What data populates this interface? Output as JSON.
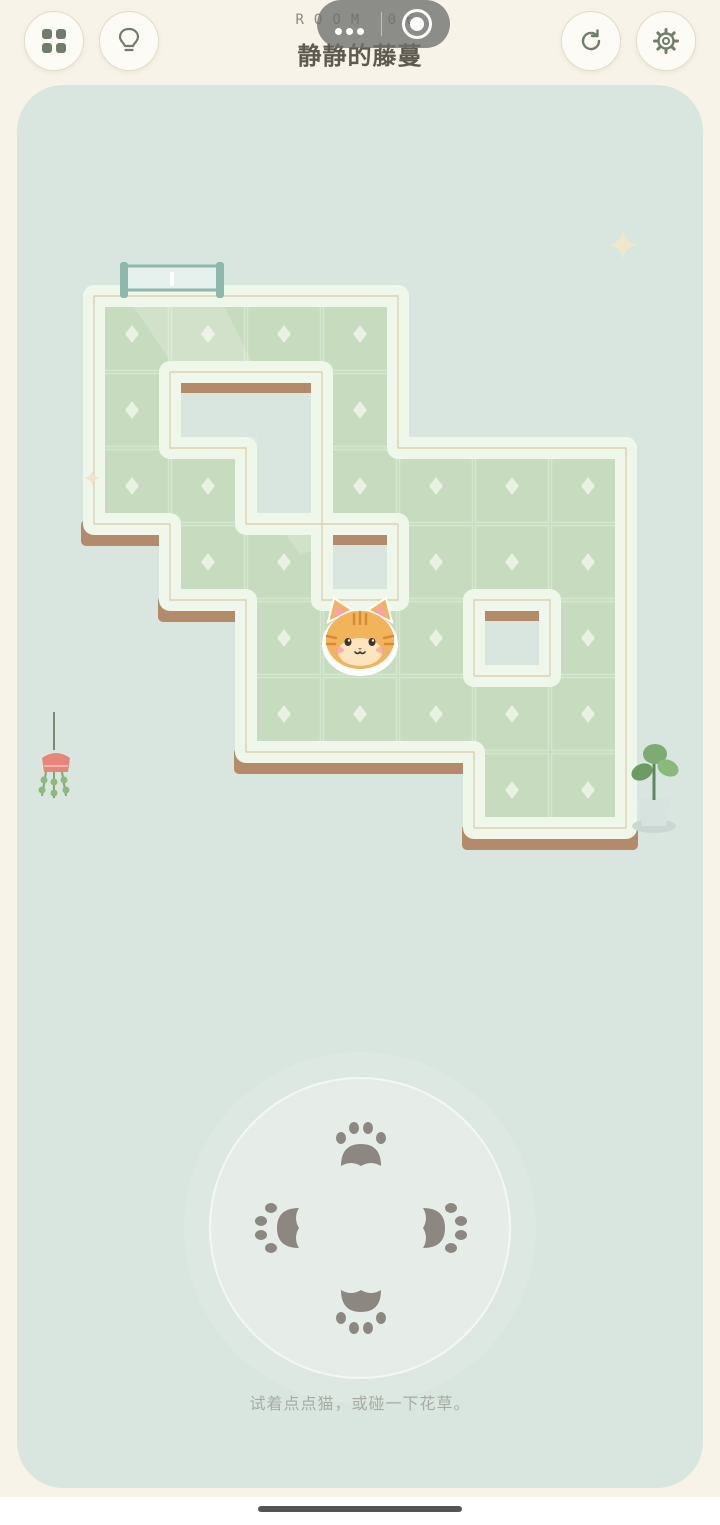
{
  "header": {
    "room_code": "ROOM 06",
    "title": "静静的藤蔓",
    "menu_icon": "grid-icon",
    "hint_icon": "lightbulb-icon",
    "restart_icon": "restart-icon",
    "settings_icon": "gear-icon"
  },
  "system": {
    "capsule_icons": [
      "more-dots-icon",
      "close-target-icon"
    ]
  },
  "board": {
    "player": "orange-tabby-cat",
    "exit": "glass-door",
    "decorations": [
      "hanging-plant",
      "potted-plant",
      "sparkle"
    ]
  },
  "controls": {
    "up_icon": "paw-up-icon",
    "left_icon": "paw-left-icon",
    "right_icon": "paw-right-icon",
    "down_icon": "paw-down-icon"
  },
  "hint_text": "试着点点猫，或碰一下花草。",
  "colors": {
    "background": "#f7f3e8",
    "panel": "#d9e6e0",
    "floor": "#c9dcc0",
    "wall": "#eef7ea",
    "wood": "#b48b6a",
    "paw": "#8c8780",
    "cat": "#f2b45a"
  }
}
